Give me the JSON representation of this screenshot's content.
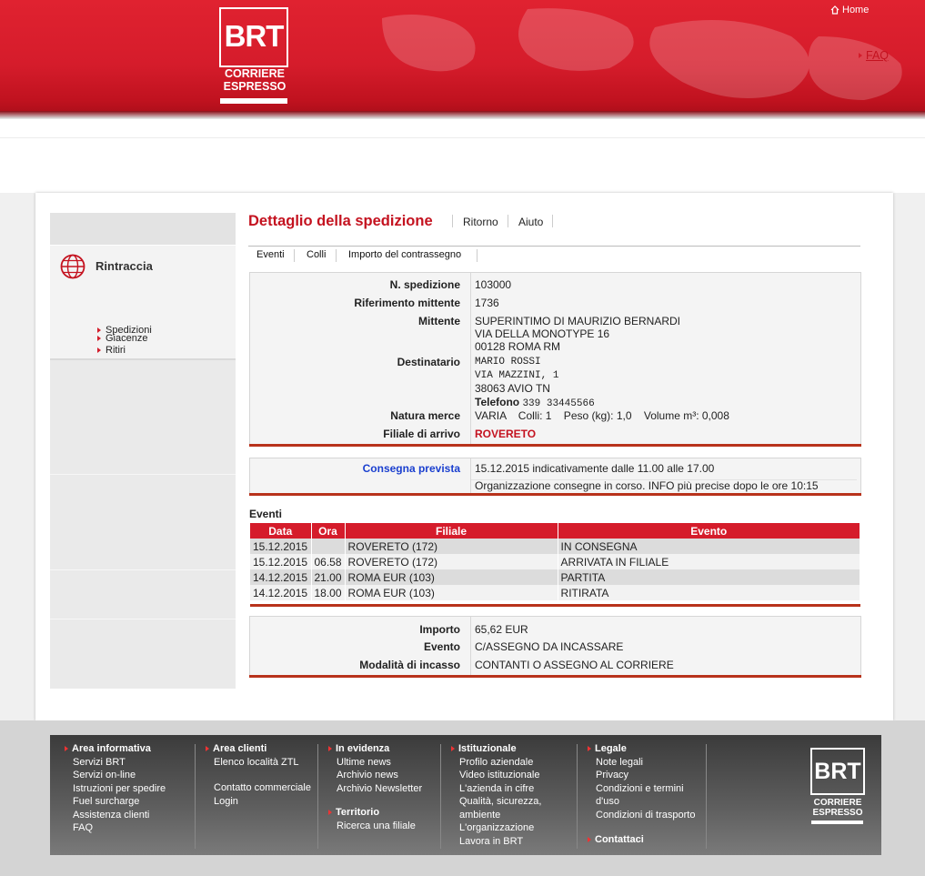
{
  "header": {
    "logo": {
      "mark": "BRT",
      "line1": "CORRIERE",
      "line2": "ESPRESSO"
    },
    "home_label": "Home",
    "faq_label": "FAQ"
  },
  "sidebar": {
    "title": "Rintraccia",
    "items": [
      {
        "label": "Spedizioni"
      },
      {
        "label": "Ritiri"
      },
      {
        "label": "Giacenze"
      }
    ]
  },
  "main": {
    "title": "Dettaglio della spedizione",
    "links": [
      "Ritorno",
      "Aiuto"
    ],
    "tabs": [
      "Eventi",
      "Colli",
      "Importo del contrassegno"
    ],
    "details": {
      "n_spedizione": {
        "label": "N. spedizione",
        "value": "103000"
      },
      "riferimento": {
        "label": "Riferimento mittente",
        "value": "1736"
      },
      "mittente": {
        "label": "Mittente",
        "line1": "SUPERINTIMO DI MAURIZIO BERNARDI",
        "line2": "VIA DELLA MONOTYPE 16",
        "line3": "00128  ROMA RM"
      },
      "destinatario": {
        "label": "Destinatario",
        "line1": "MARIO ROSSI",
        "line2": "VIA MAZZINI, 1",
        "line3": "38063  AVIO TN",
        "phone_label": "Telefono",
        "phone": "339 33445566"
      },
      "natura": {
        "label": "Natura merce",
        "value": "VARIA    Colli: 1    Peso (kg): 1,0    Volume m³: 0,008"
      },
      "filiale": {
        "label": "Filiale di arrivo",
        "value": "ROVERETO"
      }
    },
    "consegna": {
      "label": "Consegna prevista",
      "line1": "15.12.2015 indicativamente dalle 11.00 alle 17.00",
      "line2": "Organizzazione consegne in corso. INFO più precise dopo le ore 10:15"
    },
    "events": {
      "title": "Eventi",
      "columns": [
        "Data",
        "Ora",
        "Filiale",
        "Evento"
      ],
      "rows": [
        {
          "data": "15.12.2015",
          "ora": "",
          "filiale": "ROVERETO (172)",
          "evento": "IN CONSEGNA"
        },
        {
          "data": "15.12.2015",
          "ora": "06.58",
          "filiale": "ROVERETO (172)",
          "evento": "ARRIVATA IN FILIALE"
        },
        {
          "data": "14.12.2015",
          "ora": "21.00",
          "filiale": "ROMA EUR (103)",
          "evento": "PARTITA"
        },
        {
          "data": "14.12.2015",
          "ora": "18.00",
          "filiale": "ROMA EUR (103)",
          "evento": "RITIRATA"
        }
      ]
    },
    "importo": {
      "importo": {
        "label": "Importo",
        "value": "65,62 EUR"
      },
      "evento": {
        "label": "Evento",
        "value": "C/ASSEGNO DA INCASSARE"
      },
      "modalita": {
        "label": "Modalità di incasso",
        "value": "CONTANTI O ASSEGNO AL CORRIERE"
      }
    }
  },
  "footer": {
    "columns": [
      {
        "title": "Area informativa",
        "items": [
          "Servizi BRT",
          "Servizi on-line",
          "Istruzioni per spedire",
          "Fuel surcharge",
          "Assistenza clienti",
          "FAQ"
        ]
      },
      {
        "title": "Area clienti",
        "items": [
          "Elenco località ZTL",
          "Contatto commerciale",
          "Login"
        ]
      },
      {
        "title": "In evidenza",
        "items": [
          "Ultime news",
          "Archivio news",
          "Archivio Newsletter"
        ],
        "title2": "Territorio",
        "items2": [
          "Ricerca una filiale"
        ]
      },
      {
        "title": "Istituzionale",
        "items": [
          "Profilo aziendale",
          "Video istituzionale",
          "L'azienda in cifre",
          "Qualità, sicurezza, ambiente",
          "L'organizzazione",
          "Lavora in BRT"
        ]
      },
      {
        "title": "Legale",
        "items": [
          "Note legali",
          "Privacy",
          "Condizioni e termini d'uso",
          "Condizioni di trasporto"
        ],
        "title2": "Contattaci"
      }
    ],
    "logo": {
      "mark": "BRT",
      "line1": "CORRIERE",
      "line2": "ESPRESSO"
    }
  },
  "colors": {
    "brand_red": "#d51c2b",
    "accent_bar": "#b8321b",
    "link_blue": "#1a3fcf"
  }
}
